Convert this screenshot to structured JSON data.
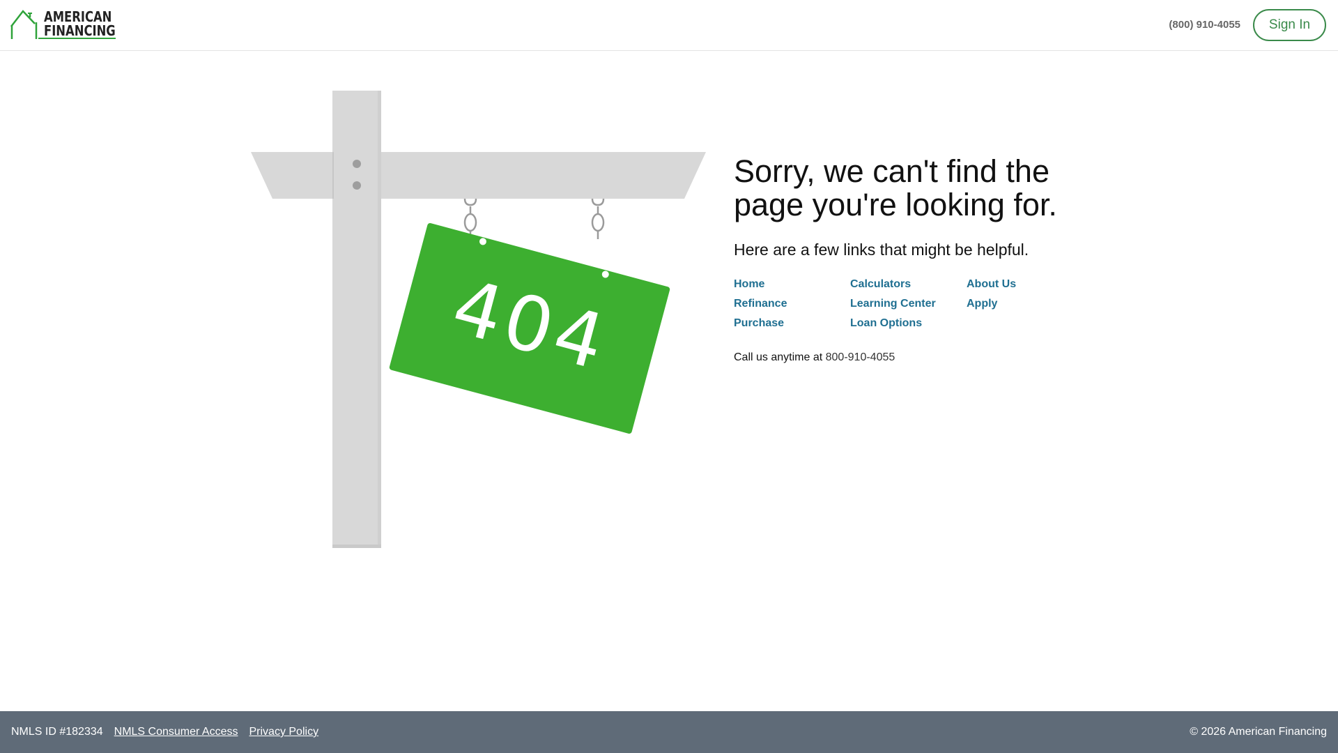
{
  "header": {
    "logo_line1": "AMERICAN",
    "logo_line2": "FINANCING",
    "phone": "(800) 910-4055",
    "sign_in_label": "Sign In"
  },
  "illustration": {
    "sign_text": "404",
    "sign_color": "#3daf30",
    "post_color": "#d8d8d8"
  },
  "main": {
    "title": "Sorry, we can't find the page you're looking for.",
    "subtitle": "Here are a few links that might be helpful.",
    "links": [
      {
        "label": "Home"
      },
      {
        "label": "Calculators"
      },
      {
        "label": "About Us"
      },
      {
        "label": "Refinance"
      },
      {
        "label": "Learning Center"
      },
      {
        "label": "Apply"
      },
      {
        "label": "Purchase"
      },
      {
        "label": "Loan Options"
      }
    ],
    "call_prefix": "Call us anytime at",
    "call_number": "800-910-4055"
  },
  "footer": {
    "nmls_id": "NMLS ID #182334",
    "nmls_consumer_access": "NMLS Consumer Access",
    "privacy_policy": "Privacy Policy",
    "copyright": "© 2026 American Financing"
  },
  "colors": {
    "brand_green": "#2fa33a",
    "link_blue": "#1f6f91",
    "footer_bg": "#5f6b78"
  }
}
